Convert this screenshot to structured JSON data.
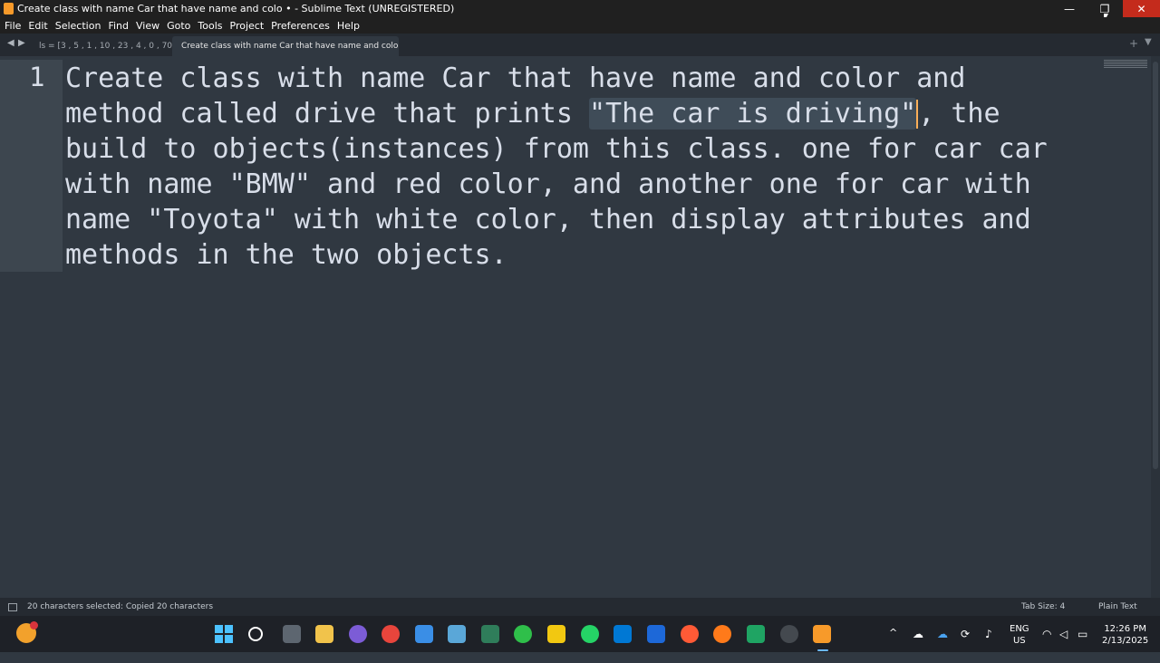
{
  "window": {
    "title": "Create class with name Car that have name and colo • - Sublime Text (UNREGISTERED)",
    "minimize_symbol": "—",
    "restore_symbol": "❐",
    "close_symbol": "✕"
  },
  "menu": [
    "File",
    "Edit",
    "Selection",
    "Find",
    "View",
    "Goto",
    "Tools",
    "Project",
    "Preferences",
    "Help"
  ],
  "tabs": [
    {
      "label": "ls = [3 , 5 , 1 , 10 , 23 , 4 , 0 , 70 ]",
      "active": false
    },
    {
      "label": "Create class with name Car that have name and colo",
      "active": true
    }
  ],
  "editor": {
    "line_number": "1",
    "lines": [
      "Create class with name Car that have name and color and",
      "method called drive that prints ",
      "build to objects(instances) from this class. one for car car",
      "with name \"BMW\" and red color, and another one for car with",
      "name \"Toyota\" with white color, then display attributes and",
      "methods in the two objects."
    ],
    "selected_text": "\"The car is driving\"",
    "after_selection": ", the"
  },
  "status": {
    "message": "20 characters selected: Copied 20 characters",
    "tab_size": "Tab Size: 4",
    "syntax": "Plain Text"
  },
  "taskbar": {
    "lang_top": "ENG",
    "lang_bottom": "US",
    "time": "12:26 PM",
    "date": "2/13/2025",
    "chevron": "^"
  },
  "colors": {
    "editor_bg": "#303841",
    "selection": "#3f4c58",
    "caret": "#f9ae58",
    "close_red": "#c42b1c"
  }
}
